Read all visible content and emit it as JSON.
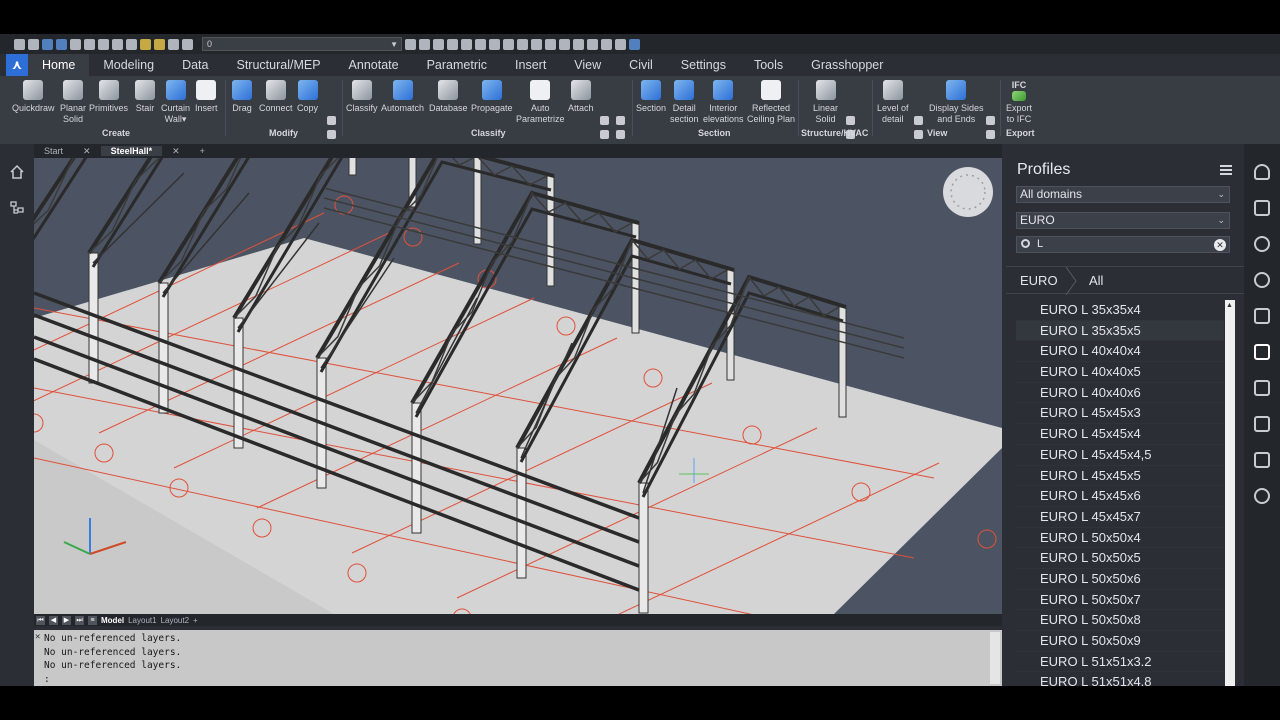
{
  "qat": {
    "layer_value": "0"
  },
  "tabs": [
    "Home",
    "Modeling",
    "Data",
    "Structural/MEP",
    "Annotate",
    "Parametric",
    "Insert",
    "View",
    "Civil",
    "Settings",
    "Tools",
    "Grasshopper"
  ],
  "ribbon": {
    "create": {
      "label": "Create",
      "quickdraw": "Quickdraw",
      "planar1": "Planar",
      "planar2": "Solid",
      "primitives": "Primitives",
      "stair": "Stair",
      "curtain1": "Curtain",
      "curtain2": "Wall▾",
      "insert": "Insert"
    },
    "modify": {
      "label": "Modify",
      "drag": "Drag",
      "connect": "Connect",
      "copy": "Copy"
    },
    "classify": {
      "label": "Classify",
      "classify": "Classify",
      "automatch": "Automatch",
      "database": "Database",
      "propagate": "Propagate",
      "auto1": "Auto",
      "auto2": "Parametrize",
      "attach": "Attach"
    },
    "section": {
      "label": "Section",
      "section": "Section",
      "detail1": "Detail",
      "detail2": "section",
      "interior1": "Interior",
      "interior2": "elevations",
      "reflected1": "Reflected",
      "reflected2": "Ceiling Plan"
    },
    "structure": {
      "label": "Structure/HVAC",
      "linear1": "Linear",
      "linear2": "Solid"
    },
    "view": {
      "label": "View",
      "lod1": "Level of",
      "lod2": "detail",
      "display1": "Display Sides",
      "display2": "and Ends"
    },
    "export": {
      "label": "Export",
      "ifc_tag": "IFC",
      "export1": "Export",
      "export2": "to IFC"
    }
  },
  "doc_tabs": {
    "start": "Start",
    "active": "SteelHall*",
    "add": "+"
  },
  "layout_tabs": [
    "Model",
    "Layout1",
    "Layout2",
    "+"
  ],
  "command_lines": [
    "No un-referenced layers.",
    "No un-referenced layers.",
    "No un-referenced layers.",
    ":"
  ],
  "profiles": {
    "title": "Profiles",
    "domain": "All domains",
    "standard": "EURO",
    "search": "L",
    "crumb_1": "EURO",
    "crumb_2": "All",
    "items": [
      "EURO L 35x35x4",
      "EURO L 35x35x5",
      "EURO L 40x40x4",
      "EURO L 40x40x5",
      "EURO L 40x40x6",
      "EURO L 45x45x3",
      "EURO L 45x45x4",
      "EURO L 45x45x4,5",
      "EURO L 45x45x5",
      "EURO L 45x45x6",
      "EURO L 45x45x7",
      "EURO L 50x50x4",
      "EURO L 50x50x5",
      "EURO L 50x50x6",
      "EURO L 50x50x7",
      "EURO L 50x50x8",
      "EURO L 50x50x9",
      "EURO L 51x51x3.2",
      "EURO L 51x51x4.8"
    ],
    "selected_index": 1
  },
  "colors": {
    "accent": "#2d6fd6",
    "grid": "#e0503a",
    "viewport_bg": "#4a5260",
    "floor": "#d6d6d6"
  }
}
